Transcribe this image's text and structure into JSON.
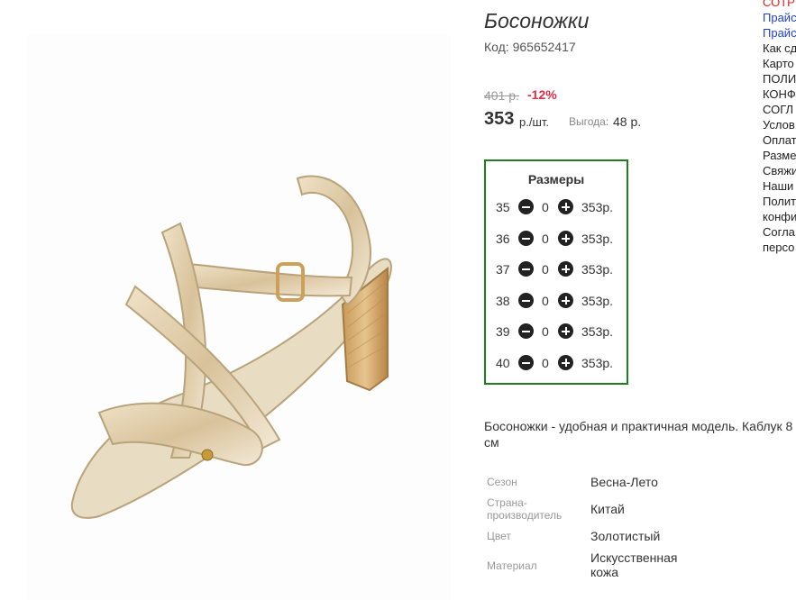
{
  "product": {
    "title": "Босоножки",
    "code_label": "Код:",
    "code_value": "965652417",
    "old_price": "401 р.",
    "discount": "-12%",
    "price": "353",
    "price_unit": "р./шт.",
    "benefit_label": "Выгода:",
    "benefit_value": "48 р.",
    "image_icon": "sandal-image",
    "description": "Босоножки - удобная и практичная модель. Каблук 8 см"
  },
  "sizes": {
    "title": "Размеры",
    "rows": [
      {
        "size": "35",
        "qty": "0",
        "price": "353р."
      },
      {
        "size": "36",
        "qty": "0",
        "price": "353р."
      },
      {
        "size": "37",
        "qty": "0",
        "price": "353р."
      },
      {
        "size": "38",
        "qty": "0",
        "price": "353р."
      },
      {
        "size": "39",
        "qty": "0",
        "price": "353р."
      },
      {
        "size": "40",
        "qty": "0",
        "price": "353р."
      }
    ],
    "minus_icon": "minus-circle-icon",
    "plus_icon": "plus-circle-icon",
    "border_color": "#1f7d1f"
  },
  "properties": [
    {
      "label": "Сезон",
      "value": "Весна-Лето"
    },
    {
      "label": "Страна-производитель",
      "value": "Китай"
    },
    {
      "label": "Цвет",
      "value": "Золотистый"
    },
    {
      "label": "Материал",
      "value": "Искусственная кожа"
    }
  ],
  "side_links": [
    {
      "text": "СОТР",
      "style": "red"
    },
    {
      "text": "Прайс",
      "style": "blue"
    },
    {
      "text": "Прайс",
      "style": "blue"
    },
    {
      "text": "Как сд",
      "style": "dark"
    },
    {
      "text": "Карто",
      "style": "dark"
    },
    {
      "text": "ПОЛИ",
      "style": "dark"
    },
    {
      "text": "КОНФ",
      "style": "dark"
    },
    {
      "text": "СОГЛ",
      "style": "dark"
    },
    {
      "text": "Услов",
      "style": "dark"
    },
    {
      "text": "Оплат",
      "style": "dark"
    },
    {
      "text": "Разме",
      "style": "dark"
    },
    {
      "text": "Свяжи",
      "style": "dark"
    },
    {
      "text": "Наши",
      "style": "dark"
    },
    {
      "text": "Полит",
      "style": "dark"
    },
    {
      "text": "конфи",
      "style": "dark"
    },
    {
      "text": "Согла",
      "style": "dark"
    },
    {
      "text": "персо",
      "style": "dark"
    }
  ],
  "colors": {
    "discount": "#e02b43",
    "link_blue": "#1e3fd0",
    "link_red": "#e02020"
  }
}
